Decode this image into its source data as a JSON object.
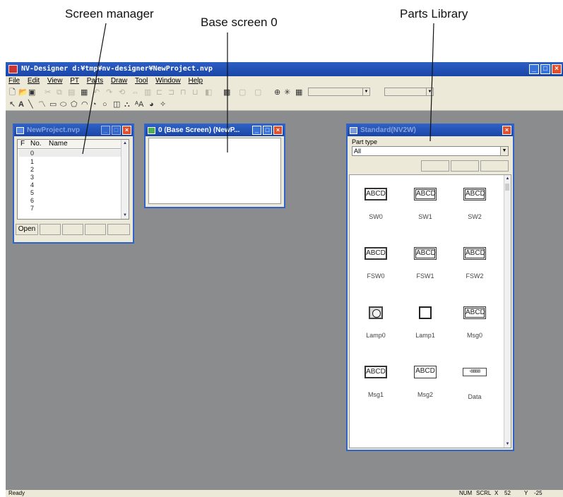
{
  "callouts": {
    "screen_manager": "Screen manager",
    "base_screen": "Base screen 0",
    "parts_library": "Parts Library"
  },
  "app": {
    "title": "NV-Designer   d:¥tmp¥nv-designer¥NewProject.nvp",
    "menus": [
      "File",
      "Edit",
      "View",
      "PT",
      "Parts",
      "Draw",
      "Tool",
      "Window",
      "Help"
    ],
    "toolbar1_icons": [
      "new-icon",
      "open-icon",
      "save-icon",
      "cut-icon",
      "copy-icon",
      "paste-icon",
      "undo-icon",
      "redo-icon",
      "align-icon",
      "grid-icon",
      "zoom-icon"
    ],
    "toolbar2_icons": [
      "pointer-icon",
      "text-icon",
      "line-icon",
      "polyline-icon",
      "rectangle-icon",
      "ellipse-icon",
      "polygon-icon",
      "arc-icon",
      "sector-icon",
      "circle-icon",
      "image-icon",
      "fill-icon",
      "text-size-icon",
      "lamp-icon",
      "star-icon"
    ]
  },
  "screen_manager": {
    "title": "NewProject.nvp",
    "headers": [
      "F",
      "No.",
      "Name"
    ],
    "rows": [
      "0",
      "1",
      "2",
      "3",
      "4",
      "5",
      "6",
      "7"
    ],
    "buttons": [
      "Open",
      "",
      "",
      "",
      ""
    ]
  },
  "base_screen": {
    "title": "0 (Base Screen) (NewP..."
  },
  "parts_library": {
    "title": "Standard(NV2W)",
    "part_type_label": "Part type",
    "part_type_value": "All",
    "parts": [
      {
        "label": "SW0",
        "icon": "ABCD"
      },
      {
        "label": "SW1",
        "icon": "ABCD"
      },
      {
        "label": "SW2",
        "icon": "ABCD"
      },
      {
        "label": "FSW0",
        "icon": "ABCD"
      },
      {
        "label": "FSW1",
        "icon": "ABCD"
      },
      {
        "label": "FSW2",
        "icon": "ABCD"
      },
      {
        "label": "Lamp0",
        "icon": ""
      },
      {
        "label": "Lamp1",
        "icon": ""
      },
      {
        "label": "Msg0",
        "icon": "ABCD"
      },
      {
        "label": "Msg1",
        "icon": "ABCD"
      },
      {
        "label": "Msg2",
        "icon": "ABCD"
      },
      {
        "label": "Data",
        "icon": "-8888"
      }
    ]
  },
  "status": {
    "ready": "Ready",
    "num": "NUM",
    "scrl": "SCRL",
    "x": "X",
    "x_val": "52",
    "y": "Y",
    "y_val": "-25"
  },
  "colors": {
    "titlebar": "#1f4fb6",
    "workspace": "#8a8c8d",
    "chrome": "#ece9d8",
    "close": "#e0502c"
  }
}
